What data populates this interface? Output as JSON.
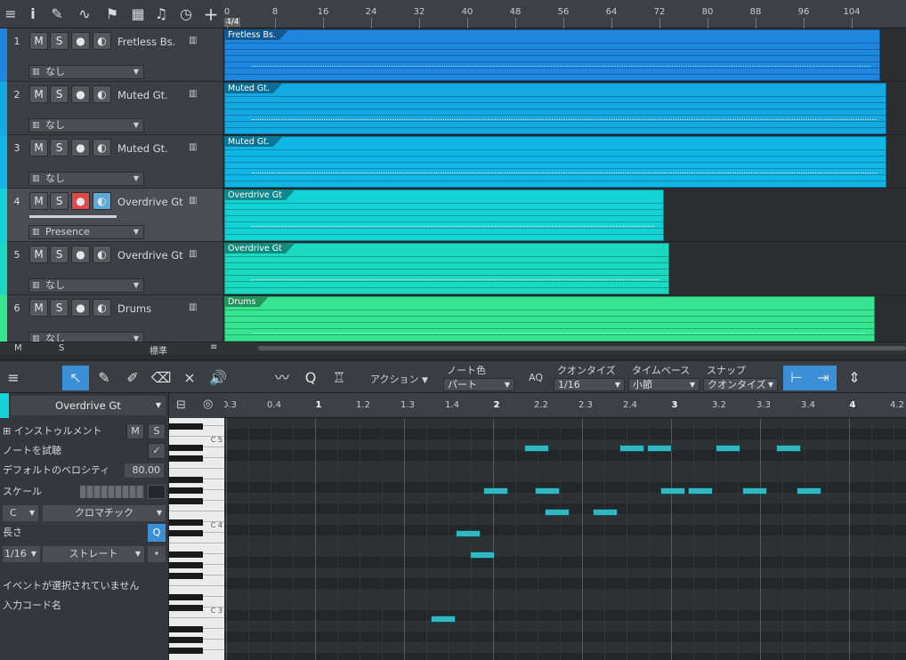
{
  "toolbar": {
    "icons": [
      "menu-icon",
      "info-icon",
      "wrench-icon",
      "automation-icon",
      "marker-icon",
      "grid-icon",
      "tempo-icon",
      "clock-icon",
      "add-icon"
    ]
  },
  "ruler": {
    "time_signature": "4/4",
    "labels": [
      "0",
      "8",
      "16",
      "24",
      "32",
      "40",
      "48",
      "56",
      "64",
      "72",
      "80",
      "88",
      "96",
      "104"
    ]
  },
  "tracks": [
    {
      "num": "2",
      "name": "Muted Gt.",
      "instrument": "なし",
      "color": "#13aae3",
      "rec": false,
      "mon": false
    },
    {
      "num": "3",
      "name": "Muted Gt.",
      "instrument": "なし",
      "color": "#10b6e6",
      "rec": false,
      "mon": false
    },
    {
      "num": "4",
      "name": "Overdrive Gt",
      "instrument": "Presence",
      "color": "#14d3d6",
      "rec": true,
      "mon": true
    },
    {
      "num": "5",
      "name": "Overdrive Gt",
      "instrument": "なし",
      "color": "#1ad9c0",
      "rec": false,
      "mon": false
    },
    {
      "num": "6",
      "name": "Drums",
      "instrument": "なし",
      "color": "#35e58f",
      "rec": false,
      "mon": false
    },
    {
      "num": "1",
      "name": "Fretless Bs.",
      "instrument": "なし",
      "color": "#1f87e0",
      "rec": false,
      "mon": false
    }
  ],
  "track_buttons": {
    "mute": "M",
    "solo": "S"
  },
  "events": [
    {
      "label": "Muted Gt.",
      "color": "#13aae3"
    },
    {
      "label": "Muted Gt.",
      "color": "#10b6e6"
    },
    {
      "label": "Overdrive Gt",
      "color": "#14d3d6"
    },
    {
      "label": "Overdrive Gt",
      "color": "#1ad9c0"
    },
    {
      "label": "Drums",
      "color": "#35e58f"
    },
    {
      "label": "Fretless Bs.",
      "color": "#1f87e0"
    }
  ],
  "strip": {
    "m": "M",
    "s": "S",
    "preset": "標準"
  },
  "editor_toolbar": {
    "action_label": "アクション",
    "note_color_label": "ノート色",
    "note_color_value": "パート",
    "aq_label": "AQ",
    "quantize_label": "クオンタイズ",
    "quantize_value": "1/16",
    "timebase_label": "タイムベース",
    "timebase_value": "小節",
    "snap_label": "スナップ",
    "snap_value": "クオンタイズ"
  },
  "inspector": {
    "track_name": "Overdrive Gt",
    "instrument_label": "インストゥルメント",
    "audition_label": "ノートを試聴",
    "velocity_label": "デフォルトのベロシティ",
    "velocity_value": "80.00",
    "scale_label": "スケール",
    "key_value": "C",
    "scale_value": "クロマチック",
    "length_label": "長さ",
    "q_label": "Q",
    "length_value": "1/16",
    "length_mode": "ストレート",
    "no_event_text": "イベントが選択されていません",
    "chord_label": "入力コード名"
  },
  "piano": {
    "labels": [
      "C 5",
      "C 4",
      "C 3"
    ]
  },
  "piano_roll_ruler": {
    "labels": [
      "0.3",
      "0.4",
      "1",
      "1.2",
      "1.3",
      "1.4",
      "2",
      "2.2",
      "2.3",
      "2.4",
      "3",
      "3.2",
      "3.3",
      "3.4",
      "4",
      "4.2"
    ]
  },
  "notes": [
    {
      "x": 0.303,
      "pitch": 2
    },
    {
      "x": 0.34,
      "pitch": 6
    },
    {
      "x": 0.36,
      "pitch": 5
    },
    {
      "x": 0.38,
      "pitch": 8
    },
    {
      "x": 0.44,
      "pitch": 10
    },
    {
      "x": 0.455,
      "pitch": 8
    },
    {
      "x": 0.47,
      "pitch": 7
    },
    {
      "x": 0.54,
      "pitch": 7
    },
    {
      "x": 0.58,
      "pitch": 10
    },
    {
      "x": 0.62,
      "pitch": 10
    },
    {
      "x": 0.64,
      "pitch": 8
    },
    {
      "x": 0.68,
      "pitch": 8
    },
    {
      "x": 0.72,
      "pitch": 10
    },
    {
      "x": 0.76,
      "pitch": 8
    },
    {
      "x": 0.81,
      "pitch": 10
    },
    {
      "x": 0.84,
      "pitch": 8
    }
  ]
}
